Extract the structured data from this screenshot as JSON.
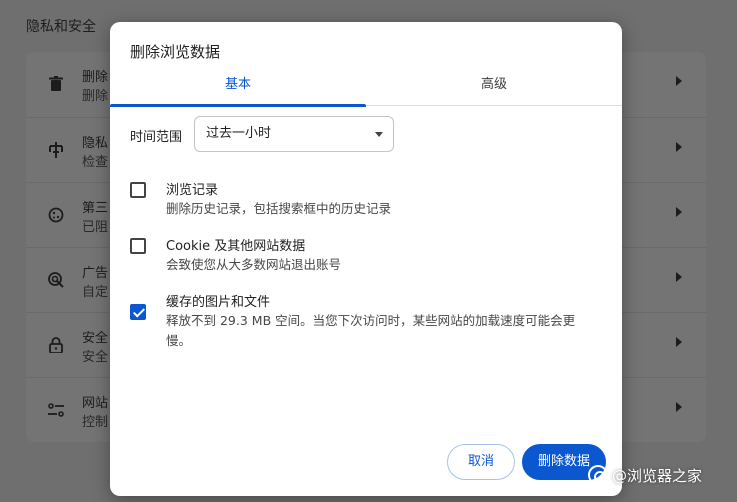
{
  "background": {
    "section_title": "隐私和安全",
    "rows": [
      {
        "icon": "trash-icon",
        "line1": "删除",
        "line2": "删除"
      },
      {
        "icon": "privacy-guide-icon",
        "line1": "隐私",
        "line2": "检查"
      },
      {
        "icon": "cookie-icon",
        "line1": "第三",
        "line2": "已阻"
      },
      {
        "icon": "ad-privacy-icon",
        "line1": "广告",
        "line2": "自定"
      },
      {
        "icon": "lock-icon",
        "line1": "安全",
        "line2": "安全"
      },
      {
        "icon": "site-settings-icon",
        "line1": "网站",
        "line2": "控制"
      }
    ]
  },
  "dialog": {
    "title": "删除浏览数据",
    "tabs": [
      {
        "label": "基本",
        "active": true
      },
      {
        "label": "高级",
        "active": false
      }
    ],
    "time_range": {
      "label": "时间范围",
      "selected": "过去一小时"
    },
    "options": [
      {
        "title": "浏览记录",
        "desc": "删除历史记录，包括搜索框中的历史记录",
        "checked": false
      },
      {
        "title": "Cookie 及其他网站数据",
        "desc": "会致使您从大多数网站退出账号",
        "checked": false
      },
      {
        "title": "缓存的图片和文件",
        "desc": "释放不到 29.3 MB 空间。当您下次访问时，某些网站的加载速度可能会更慢。",
        "checked": true
      }
    ],
    "buttons": {
      "cancel": "取消",
      "delete": "删除数据"
    }
  },
  "watermark": "@浏览器之家",
  "colors": {
    "accent": "#0b57d0",
    "overlay": "#6f6f6f"
  }
}
